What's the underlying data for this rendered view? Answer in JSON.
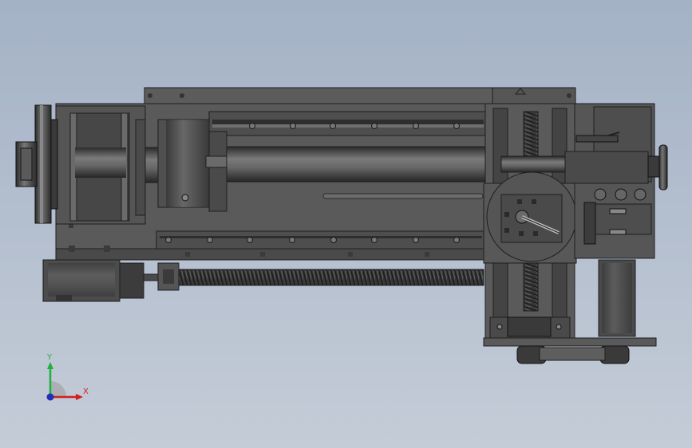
{
  "viewport": {
    "background_top": "#a4b2c6",
    "background_bottom": "#c4ccd7"
  },
  "triad": {
    "x_label": "X",
    "y_label": "Y",
    "x_color": "#d21e1e",
    "y_color": "#1fb040",
    "z_color": "#1f2fb8"
  }
}
